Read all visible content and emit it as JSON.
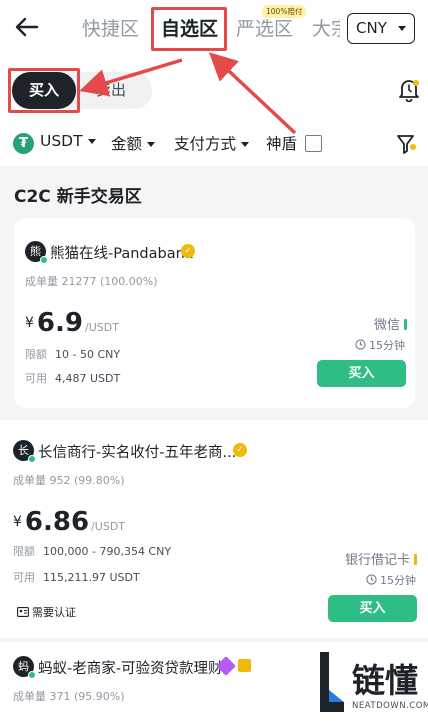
{
  "header": {
    "tabs": [
      {
        "label": "快捷区"
      },
      {
        "label": "自选区"
      },
      {
        "label": "严选区"
      },
      {
        "label": "大宗"
      }
    ],
    "strict_badge": "100%赔付",
    "currency": "CNY"
  },
  "toggle": {
    "buy": "买入",
    "sell": "卖出"
  },
  "filters": {
    "coin": "USDT",
    "amount": "金额",
    "payment": "支付方式",
    "shield": "神盾"
  },
  "section_title": "C2C 新手交易区",
  "ads": [
    {
      "avatar_char": "熊",
      "merchant": "熊猫在线-Pandabank",
      "stat_label": "成单量",
      "stat_value": "21277 (100.00%)",
      "currency_symbol": "¥",
      "price": "6.9",
      "unit": "/USDT",
      "limit_label": "限额",
      "limit": "10 - 50 CNY",
      "available_label": "可用",
      "available": "4,487 USDT",
      "payment": "微信",
      "payment_color": "#2ebd85",
      "time": "15分钟",
      "button": "买入"
    },
    {
      "avatar_char": "长",
      "merchant": "长信商行-实名收付-五年老商...",
      "stat_label": "成单量",
      "stat_value": "952 (99.80%)",
      "currency_symbol": "¥",
      "price": "6.86",
      "unit": "/USDT",
      "limit_label": "限额",
      "limit": "100,000 - 790,354 CNY",
      "available_label": "可用",
      "available": "115,211.97 USDT",
      "payment": "银行借记卡",
      "payment_color": "#f0b90b",
      "time": "15分钟",
      "verify_tag": "需要认证",
      "button": "买入"
    },
    {
      "avatar_char": "蚂",
      "merchant": "蚂蚁-老商家-可验资贷款理财",
      "stat_label": "成单量",
      "stat_value": "371 (95.90%)"
    }
  ],
  "watermark": {
    "text": "链懂",
    "sub": "NEATDOWN.COM"
  },
  "colors": {
    "accent_green": "#2ebd85",
    "annotation_red": "#e34a4a",
    "dark": "#1e2329"
  }
}
